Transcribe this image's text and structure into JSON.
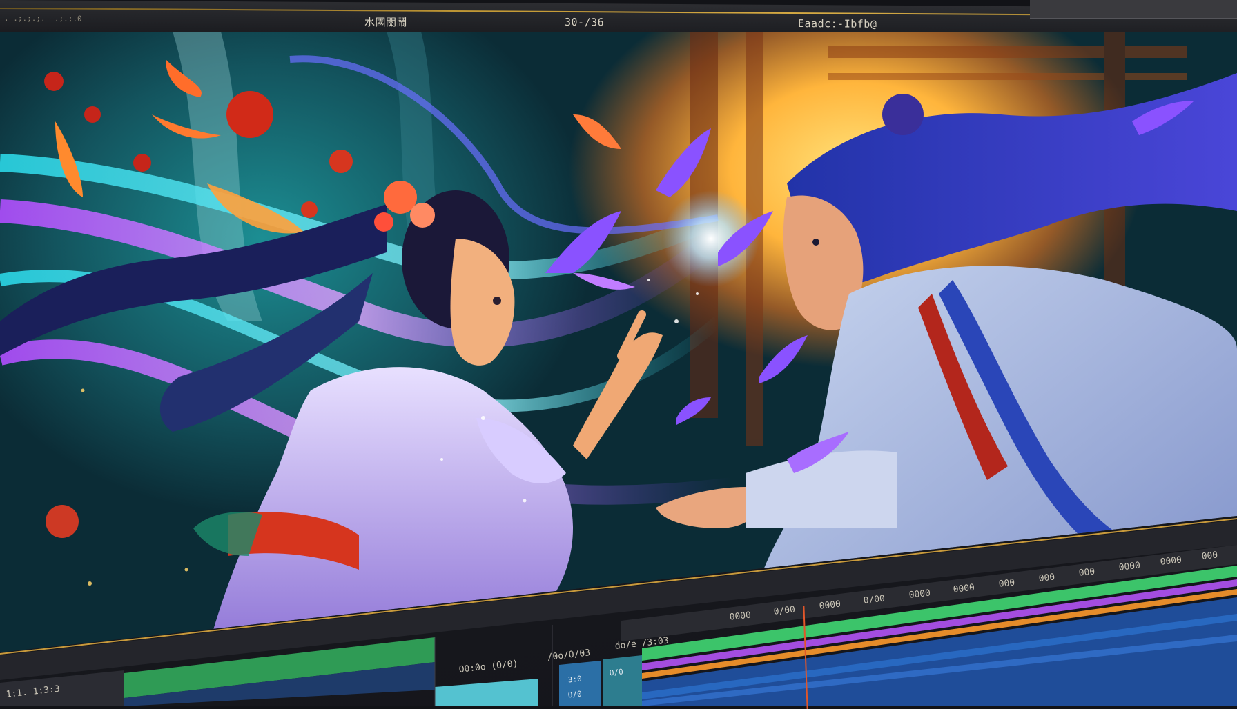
{
  "top_bar": {
    "left_label": ". .;.;.;. -.;.;.0",
    "center_left_label": "水國關鬧",
    "center_label": "30-/36",
    "right_label": "Eaadc:-Ibfb@"
  },
  "timeline": {
    "row_label": "1:1. 1:3:3",
    "clip_labels": [
      "O0:0o (O/0)",
      "/0o/O/03",
      "do/e /3:03"
    ],
    "clip_chip_labels": [
      "3:0",
      "O/0",
      "O/0"
    ],
    "ruler_marks": [
      "0000",
      "0/00",
      "0000",
      "0/00",
      "0000",
      "0000",
      "000",
      "000",
      "000",
      "0000",
      "0000",
      "000"
    ],
    "track_colors": {
      "green": "#3cc46a",
      "purple": "#a34de0",
      "orange": "#e58c2a",
      "blue": "#2a6fc9",
      "playhead": "#e0562a"
    }
  }
}
